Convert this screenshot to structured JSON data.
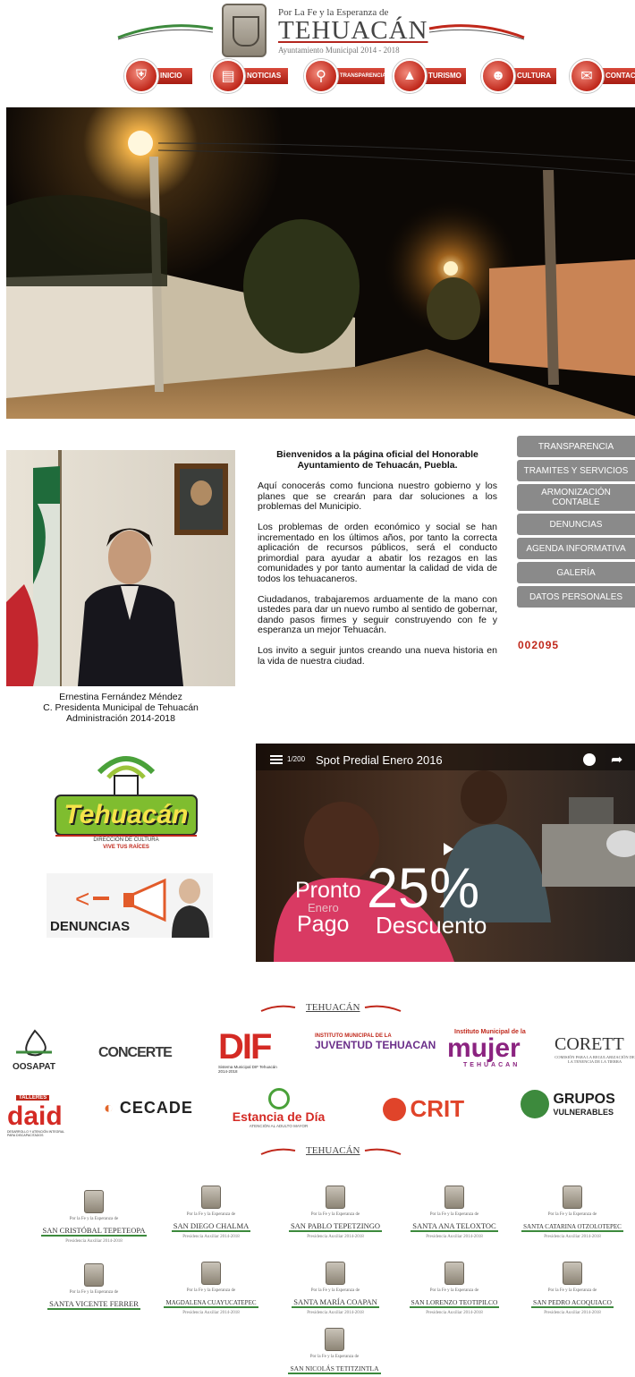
{
  "header": {
    "motto": "Por La Fe y la Esperanza de",
    "city": "TEHUACÁN",
    "subtitle": "Ayuntamiento Municipal 2014 - 2018",
    "nav": [
      {
        "label": "INICIO",
        "icon": "shield-icon"
      },
      {
        "label": "NOTICIAS",
        "icon": "newspaper-icon"
      },
      {
        "label": "TRANSPARENCIA",
        "icon": "magnifier-icon"
      },
      {
        "label": "TURISMO",
        "icon": "landscape-icon"
      },
      {
        "label": "CULTURA",
        "icon": "mask-icon"
      },
      {
        "label": "CONTACTO",
        "icon": "envelope-icon"
      }
    ]
  },
  "welcome": {
    "title": "Bienvenidos a la página oficial del Honorable Ayuntamiento de Tehuacán, Puebla.",
    "paragraphs": [
      "Aquí conocerás como funciona nuestro gobierno y los planes que se crearán para dar soluciones a los problemas del Municipio.",
      "Los problemas de orden económico y social se han incrementado en los últimos años, por tanto la correcta aplicación de recursos públicos, será el conducto primordial para ayudar a abatir los rezagos en las comunidades y por tanto aumentar la calidad de vida de todos los tehuacaneros.",
      "Ciudadanos, trabajaremos arduamente de la mano con ustedes para dar un nuevo rumbo al sentido de gobernar, dando pasos firmes y seguir construyendo con fe y esperanza un mejor Tehuacán.",
      "Los invito a seguir juntos creando una nueva historia en la vida de nuestra ciudad."
    ],
    "caption": [
      "Ernestina Fernández Méndez",
      "C. Presidenta Municipal de Tehuacán",
      "Administración 2014-2018"
    ]
  },
  "side_menu": [
    "TRANSPARENCIA",
    "TRAMITES Y SERVICIOS",
    "ARMONIZACIÓN CONTABLE",
    "DENUNCIAS",
    "AGENDA INFORMATIVA",
    "GALERÍA",
    "DATOS PERSONALES"
  ],
  "counter": "002095",
  "cultura": {
    "logo_text": "Tehuacán",
    "line1": "DIRECCIÓN DE CULTURA",
    "line2": "VIVE TUS RAÍCES"
  },
  "denuncias_banner": "DENUNCIAS",
  "video": {
    "playlist": "1/200",
    "title": "Spot Predial Enero 2016",
    "overlay_pronto": "Pronto",
    "overlay_enero": "Enero",
    "overlay_pago": "Pago",
    "overlay_pct": "25%",
    "overlay_descuento": "Descuento"
  },
  "partners_row1": [
    "OOSAPAT",
    "CONCERTE",
    "DIF",
    "JUVENTUD TEHUACAN",
    "mujer",
    "CORETT"
  ],
  "partners_row2": [
    "daid",
    "CECADE",
    "Estancia de Día",
    "CRIT",
    "GRUPOS VULNERABLES"
  ],
  "partner_captions": {
    "dif": "Sistema Municipal DIF Tehuacán 2014-2018",
    "juventud_top": "INSTITUTO MUNICIPAL DE LA",
    "mujer_top": "Instituto Municipal de la",
    "mujer_bottom": "TEHUACAN",
    "corett_sub": "COMISIÓN PARA LA REGULARIZACIÓN DE LA TENENCIA DE LA TIERRA",
    "daid_top": "TALLERES",
    "daid_sub": "DESARROLLO Y ATENCIÓN INTEGRAL PARA DISCAPACITADOS",
    "estancia_sub": "ATENCIÓN AL ADULTO MAYOR",
    "grupos_line1": "GRUPOS",
    "grupos_line2": "VULNERABLES"
  },
  "juntas": {
    "motto": "Por la Fe y la Esperanza de",
    "period": "Presidencia Auxiliar 2014-2018",
    "names": [
      "SAN CRISTÓBAL TEPETEOPA",
      "SAN DIEGO CHALMA",
      "SAN PABLO TEPETZINGO",
      "SANTA ANA TELOXTOC",
      "SANTA CATARINA OTZOLOTEPEC",
      "SANTA VICENTE FERRER",
      "MAGDALENA CUAYUCATEPEC",
      "SANTA MARÍA COAPAN",
      "SAN LORENZO TEOTIPILCO",
      "SAN PEDRO ACOQUIACO",
      "SAN NICOLÁS TETITZINTLA"
    ]
  },
  "colors": {
    "brand_red": "#c0281b",
    "menu_gray": "#8a8a8a",
    "counter_red": "#c0281b"
  }
}
